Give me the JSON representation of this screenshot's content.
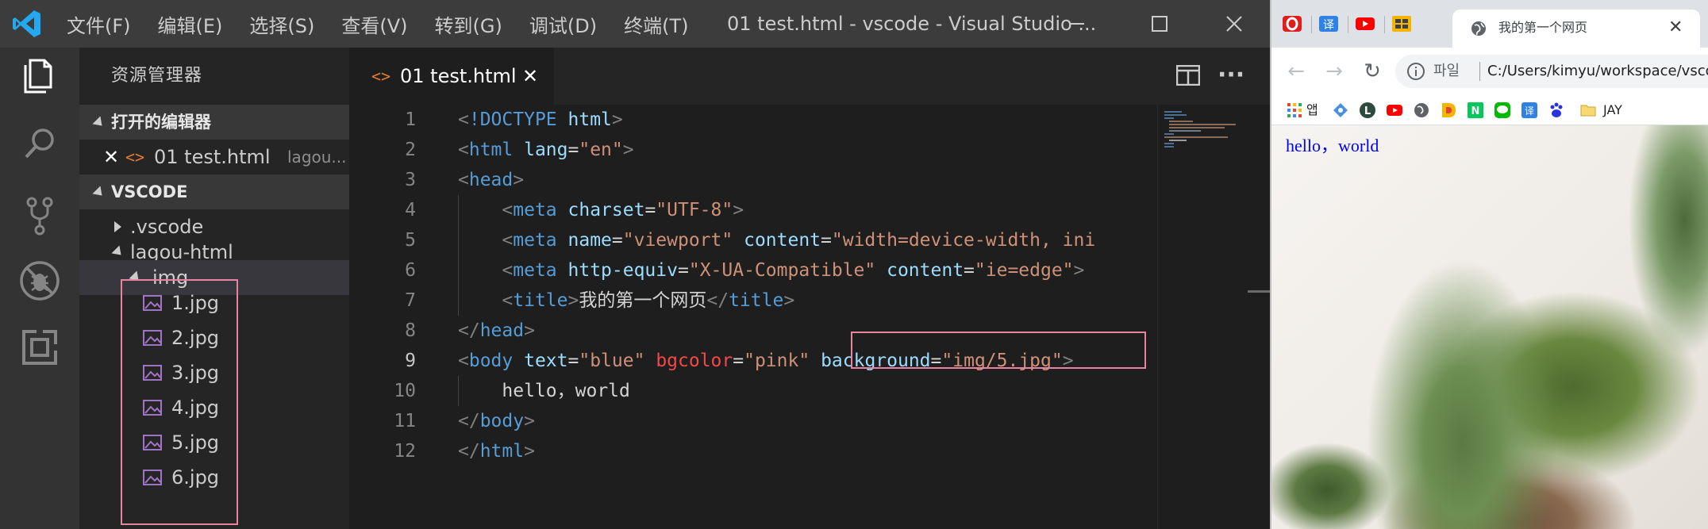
{
  "vscode": {
    "menu": [
      "文件(F)",
      "编辑(E)",
      "选择(S)",
      "查看(V)",
      "转到(G)",
      "调试(D)",
      "终端(T)"
    ],
    "window_title": "01 test.html - vscode - Visual Studio ...",
    "explorer_title": "资源管理器",
    "open_editors_label": "打开的编辑器",
    "open_editor_item": {
      "name": "01 test.html",
      "path": "lagou..."
    },
    "workspace_label": "VSCODE",
    "tree": {
      "vscode_folder": ".vscode",
      "lagou_folder": "lagou-html",
      "img_folder": "img",
      "files": [
        "1.jpg",
        "2.jpg",
        "3.jpg",
        "4.jpg",
        "5.jpg",
        "6.jpg"
      ]
    },
    "tab_label": "01 test.html",
    "tab_close": "✕",
    "line_numbers": [
      "1",
      "2",
      "3",
      "4",
      "5",
      "6",
      "7",
      "8",
      "9",
      "10",
      "11",
      "12"
    ],
    "active_line": "9",
    "code": {
      "l1": {
        "lt": "<",
        "bang": "!DOCTYPE",
        "sp": " ",
        "attr": "html",
        "gt": ">"
      },
      "l2": {
        "lt": "<",
        "tag": "html",
        "sp": " ",
        "attr": "lang",
        "eq": "=",
        "val": "\"en\"",
        "gt": ">"
      },
      "l3": {
        "lt": "<",
        "tag": "head",
        "gt": ">"
      },
      "l4": {
        "indent": "    ",
        "lt": "<",
        "tag": "meta",
        "sp": " ",
        "attr": "charset",
        "eq": "=",
        "val": "\"UTF-8\"",
        "gt": ">"
      },
      "l5": {
        "indent": "    ",
        "lt": "<",
        "tag": "meta",
        "sp1": " ",
        "attr1": "name",
        "eq1": "=",
        "val1": "\"viewport\"",
        "sp2": " ",
        "attr2": "content",
        "eq2": "=",
        "val2": "\"width=device-width, ini"
      },
      "l6": {
        "indent": "    ",
        "lt": "<",
        "tag": "meta",
        "sp1": " ",
        "attr1": "http-equiv",
        "eq1": "=",
        "val1": "\"X-UA-Compatible\"",
        "sp2": " ",
        "attr2": "content",
        "eq2": "=",
        "val2": "\"ie=edge\"",
        "gt": ">"
      },
      "l7": {
        "indent": "    ",
        "lt": "<",
        "tag": "title",
        "gt": ">",
        "text": "我的第一个网页",
        "lt2": "</",
        "tag2": "title",
        "gt2": ">"
      },
      "l8": {
        "lt": "</",
        "tag": "head",
        "gt": ">"
      },
      "l9": {
        "lt": "<",
        "tag": "body",
        "sp1": " ",
        "attr1": "text",
        "eq1": "=",
        "val1": "\"blue\"",
        "sp2": " ",
        "attr2": "bgcolor",
        "eq2": "=",
        "val2": "\"pink\"",
        "sp3": " ",
        "attr3": "background",
        "eq3": "=",
        "val3": "\"img/5.jpg\"",
        "gt": ">"
      },
      "l10": {
        "indent": "    ",
        "text": "hello，world"
      },
      "l11": {
        "lt": "</",
        "tag": "body",
        "gt": ">"
      },
      "l12": {
        "lt": "</",
        "tag": "html",
        "gt": ">"
      }
    },
    "colors": {
      "highlight_border": "#e8849f",
      "accent": "#007acc"
    }
  },
  "chrome": {
    "tab_title": "我的第一个网页",
    "tab_close": "✕",
    "omnibox_scheme": "파일",
    "omnibox_url": "C:/Users/kimyu/workspace/vscode",
    "bookmarks": {
      "apps_label": "앱",
      "last_label": "JAY"
    },
    "page_text": "hello，world",
    "page_text_color": "#0000ff"
  }
}
